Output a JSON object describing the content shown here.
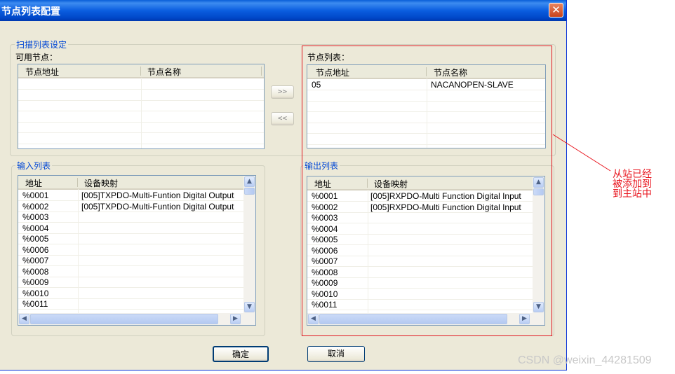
{
  "window": {
    "title": "节点列表配置",
    "close_icon": "close-icon"
  },
  "scan_group": {
    "label": "扫描列表设定"
  },
  "available_nodes": {
    "label": "可用节点：",
    "columns": [
      "节点地址",
      "节点名称"
    ],
    "rows": []
  },
  "node_list": {
    "label": "节点列表：",
    "columns": [
      "节点地址",
      "节点名称"
    ],
    "rows": [
      {
        "addr": "05",
        "name": "NACANOPEN-SLAVE"
      }
    ]
  },
  "transfer": {
    "add_label": ">>",
    "remove_label": "<<"
  },
  "input_list": {
    "label": "输入列表",
    "columns": [
      "地址",
      "设备映射"
    ],
    "rows": [
      {
        "addr": "%0001",
        "map": "[005]TXPDO-Multi-Funtion Digital Output"
      },
      {
        "addr": "%0002",
        "map": "[005]TXPDO-Multi-Funtion Digital Output"
      },
      {
        "addr": "%0003",
        "map": ""
      },
      {
        "addr": "%0004",
        "map": ""
      },
      {
        "addr": "%0005",
        "map": ""
      },
      {
        "addr": "%0006",
        "map": ""
      },
      {
        "addr": "%0007",
        "map": ""
      },
      {
        "addr": "%0008",
        "map": ""
      },
      {
        "addr": "%0009",
        "map": ""
      },
      {
        "addr": "%0010",
        "map": ""
      },
      {
        "addr": "%0011",
        "map": ""
      }
    ]
  },
  "output_list": {
    "label": "输出列表",
    "columns": [
      "地址",
      "设备映射"
    ],
    "rows": [
      {
        "addr": "%0001",
        "map": "[005]RXPDO-Multi Function Digital Input"
      },
      {
        "addr": "%0002",
        "map": "[005]RXPDO-Multi Function Digital Input"
      },
      {
        "addr": "%0003",
        "map": ""
      },
      {
        "addr": "%0004",
        "map": ""
      },
      {
        "addr": "%0005",
        "map": ""
      },
      {
        "addr": "%0006",
        "map": ""
      },
      {
        "addr": "%0007",
        "map": ""
      },
      {
        "addr": "%0008",
        "map": ""
      },
      {
        "addr": "%0009",
        "map": ""
      },
      {
        "addr": "%0010",
        "map": ""
      },
      {
        "addr": "%0011",
        "map": ""
      }
    ]
  },
  "buttons": {
    "ok": "确定",
    "cancel": "取消"
  },
  "annotation": {
    "text": "从站已经被添加到到主站中",
    "color": "#e8121b"
  },
  "watermark": "CSDN @weixin_44281509"
}
